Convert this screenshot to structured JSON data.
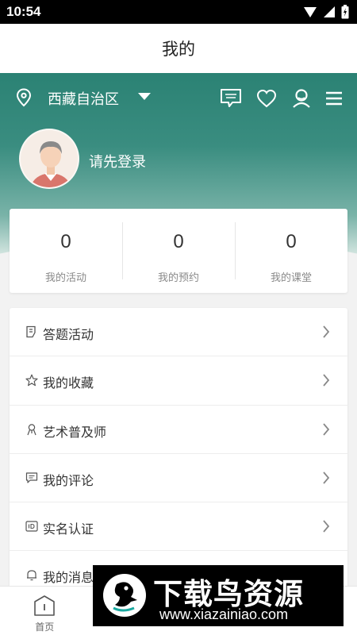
{
  "status_bar": {
    "time": "10:54"
  },
  "title_bar": {
    "title": "我的"
  },
  "header": {
    "region": "西藏自治区",
    "icons": [
      "tibetan-language-icon",
      "heart-icon",
      "user-profile-icon",
      "menu-icon"
    ],
    "login_prompt": "请先登录"
  },
  "stats": [
    {
      "value": "0",
      "label": "我的活动"
    },
    {
      "value": "0",
      "label": "我的预约"
    },
    {
      "value": "0",
      "label": "我的课堂"
    }
  ],
  "menu": [
    {
      "label": "答题活动",
      "icon": "quiz-icon"
    },
    {
      "label": "我的收藏",
      "icon": "star-icon"
    },
    {
      "label": "艺术普及师",
      "icon": "artist-icon"
    },
    {
      "label": "我的评论",
      "icon": "comment-icon"
    },
    {
      "label": "实名认证",
      "icon": "id-card-icon"
    },
    {
      "label": "我的消息",
      "icon": "bell-icon"
    }
  ],
  "bottom_nav": [
    {
      "label": "首页",
      "icon": "home-icon"
    },
    {
      "label": ""
    },
    {
      "label": ""
    },
    {
      "label": "",
      "active": true
    }
  ],
  "watermark": {
    "title": "下载鸟资源",
    "url": "www.xiazainiao.com"
  },
  "colors": {
    "accent": "#2b8274",
    "background": "#f2f2f2"
  }
}
